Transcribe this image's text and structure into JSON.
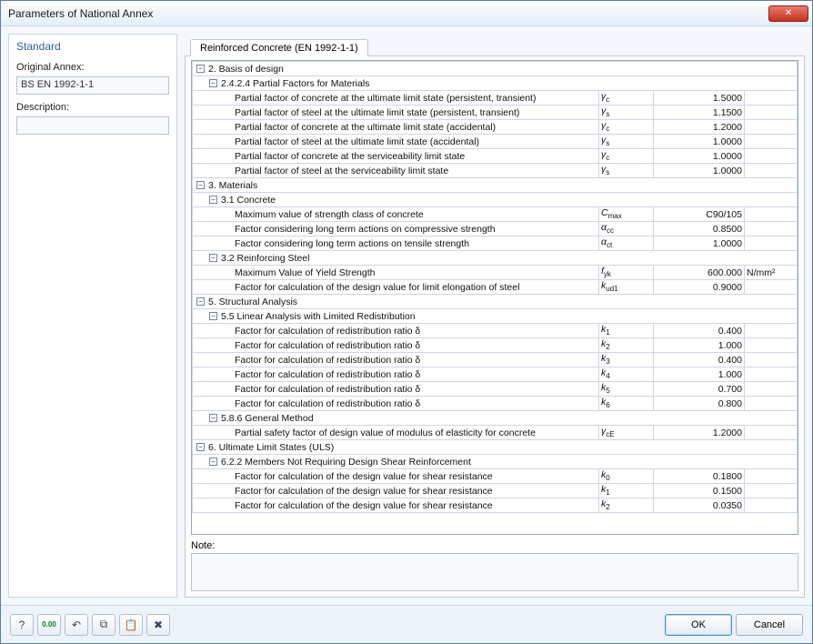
{
  "window": {
    "title": "Parameters of National Annex"
  },
  "sidebar": {
    "heading": "Standard",
    "original_label": "Original Annex:",
    "original_value": "BS EN 1992-1-1",
    "description_label": "Description:",
    "description_value": ""
  },
  "tabs": {
    "active": "Reinforced Concrete (EN 1992-1-1)"
  },
  "note": {
    "label": "Note:"
  },
  "buttons": {
    "ok": "OK",
    "cancel": "Cancel"
  },
  "toolbar_icons": [
    "help",
    "decimals",
    "undo",
    "copy",
    "paste",
    "delete"
  ],
  "tree": [
    {
      "lvl": 0,
      "t": "h",
      "txt": "2. Basis of design"
    },
    {
      "lvl": 1,
      "t": "h",
      "txt": "2.4.2.4 Partial Factors for Materials"
    },
    {
      "lvl": 2,
      "t": "r",
      "txt": "Partial factor of concrete at the ultimate limit state (persistent, transient)",
      "sym": "γ<sub>c</sub>",
      "val": "1.5000"
    },
    {
      "lvl": 2,
      "t": "r",
      "txt": "Partial factor of steel at the ultimate limit state (persistent, transient)",
      "sym": "γ<sub>s</sub>",
      "val": "1.1500"
    },
    {
      "lvl": 2,
      "t": "r",
      "txt": "Partial factor of concrete at the ultimate limit state (accidental)",
      "sym": "γ<sub>c</sub>",
      "val": "1.2000"
    },
    {
      "lvl": 2,
      "t": "r",
      "txt": "Partial factor of steel at the ultimate limit state (accidental)",
      "sym": "γ<sub>s</sub>",
      "val": "1.0000"
    },
    {
      "lvl": 2,
      "t": "r",
      "txt": "Partial factor of concrete at the serviceability limit state",
      "sym": "γ<sub>c</sub>",
      "val": "1.0000"
    },
    {
      "lvl": 2,
      "t": "r",
      "txt": "Partial factor of steel at the serviceability limit state",
      "sym": "γ<sub>s</sub>",
      "val": "1.0000"
    },
    {
      "lvl": 0,
      "t": "h",
      "txt": "3. Materials"
    },
    {
      "lvl": 1,
      "t": "h",
      "txt": "3.1 Concrete"
    },
    {
      "lvl": 2,
      "t": "r",
      "txt": "Maximum value of strength class of concrete",
      "sym": "C<sub>max</sub>",
      "val": "C90/105"
    },
    {
      "lvl": 2,
      "t": "r",
      "txt": "Factor considering long term actions on compressive strength",
      "sym": "α<sub>cc</sub>",
      "val": "0.8500"
    },
    {
      "lvl": 2,
      "t": "r",
      "txt": "Factor considering long term actions on tensile strength",
      "sym": "α<sub>ct</sub>",
      "val": "1.0000"
    },
    {
      "lvl": 1,
      "t": "h",
      "txt": "3.2 Reinforcing Steel"
    },
    {
      "lvl": 2,
      "t": "r",
      "txt": "Maximum Value of Yield Strength",
      "sym": "f<sub>yk</sub>",
      "val": "600.000",
      "unit": "N/mm²"
    },
    {
      "lvl": 2,
      "t": "r",
      "txt": "Factor for calculation of the design value for limit elongation of steel",
      "sym": "k<sub>ud1</sub>",
      "val": "0.9000"
    },
    {
      "lvl": 0,
      "t": "h",
      "txt": "5. Structural Analysis"
    },
    {
      "lvl": 1,
      "t": "h",
      "txt": "5.5 Linear Analysis with Limited Redistribution"
    },
    {
      "lvl": 2,
      "t": "r",
      "txt": "Factor for calculation of redistribution ratio δ",
      "sym": "k<sub>1</sub>",
      "val": "0.400"
    },
    {
      "lvl": 2,
      "t": "r",
      "txt": "Factor for calculation of redistribution ratio δ",
      "sym": "k<sub>2</sub>",
      "val": "1.000"
    },
    {
      "lvl": 2,
      "t": "r",
      "txt": "Factor for calculation of redistribution ratio δ",
      "sym": "k<sub>3</sub>",
      "val": "0.400"
    },
    {
      "lvl": 2,
      "t": "r",
      "txt": "Factor for calculation of redistribution ratio δ",
      "sym": "k<sub>4</sub>",
      "val": "1.000"
    },
    {
      "lvl": 2,
      "t": "r",
      "txt": "Factor for calculation of redistribution ratio δ",
      "sym": "k<sub>5</sub>",
      "val": "0.700"
    },
    {
      "lvl": 2,
      "t": "r",
      "txt": "Factor for calculation of redistribution ratio δ",
      "sym": "k<sub>6</sub>",
      "val": "0.800"
    },
    {
      "lvl": 1,
      "t": "h",
      "txt": "5.8.6 General Method"
    },
    {
      "lvl": 2,
      "t": "r",
      "txt": "Partial safety factor of design value of modulus of elasticity for concrete",
      "sym": "γ<sub>cE</sub>",
      "val": "1.2000"
    },
    {
      "lvl": 0,
      "t": "h",
      "txt": "6. Ultimate Limit States (ULS)"
    },
    {
      "lvl": 1,
      "t": "h",
      "txt": "6.2.2 Members Not Requiring Design Shear Reinforcement"
    },
    {
      "lvl": 2,
      "t": "r",
      "txt": "Factor for calculation of the design value for shear resistance",
      "sym": "k<sub>0</sub>",
      "val": "0.1800"
    },
    {
      "lvl": 2,
      "t": "r",
      "txt": "Factor for calculation of the design value for shear resistance",
      "sym": "k<sub>1</sub>",
      "val": "0.1500"
    },
    {
      "lvl": 2,
      "t": "r",
      "txt": "Factor for calculation of the design value for shear resistance",
      "sym": "k<sub>2</sub>",
      "val": "0.0350"
    }
  ]
}
